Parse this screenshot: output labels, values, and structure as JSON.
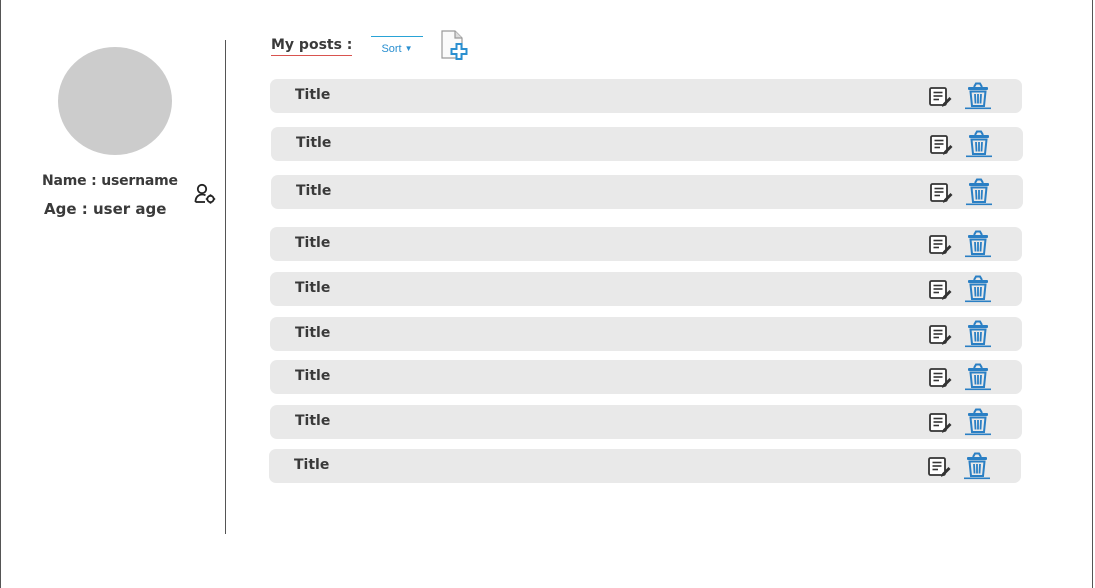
{
  "profile": {
    "name_label": "Name : username",
    "age_label": "Age : user age",
    "settings_icon": "user-settings-icon"
  },
  "posts": {
    "header": "My posts :",
    "sort_label": "Sort",
    "add_icon": "add-document-icon",
    "edit_icon": "edit-list-icon",
    "delete_icon": "trash-icon",
    "items": [
      {
        "title": "Title"
      },
      {
        "title": "Title"
      },
      {
        "title": "Title"
      },
      {
        "title": "Title"
      },
      {
        "title": "Title"
      },
      {
        "title": "Title"
      },
      {
        "title": "Title"
      },
      {
        "title": "Title"
      },
      {
        "title": "Title"
      }
    ]
  },
  "colors": {
    "accent_blue": "#2a8fd0",
    "row_background": "#e9e9e9",
    "avatar_gray": "#cccccc",
    "header_underline": "#d9534f"
  }
}
